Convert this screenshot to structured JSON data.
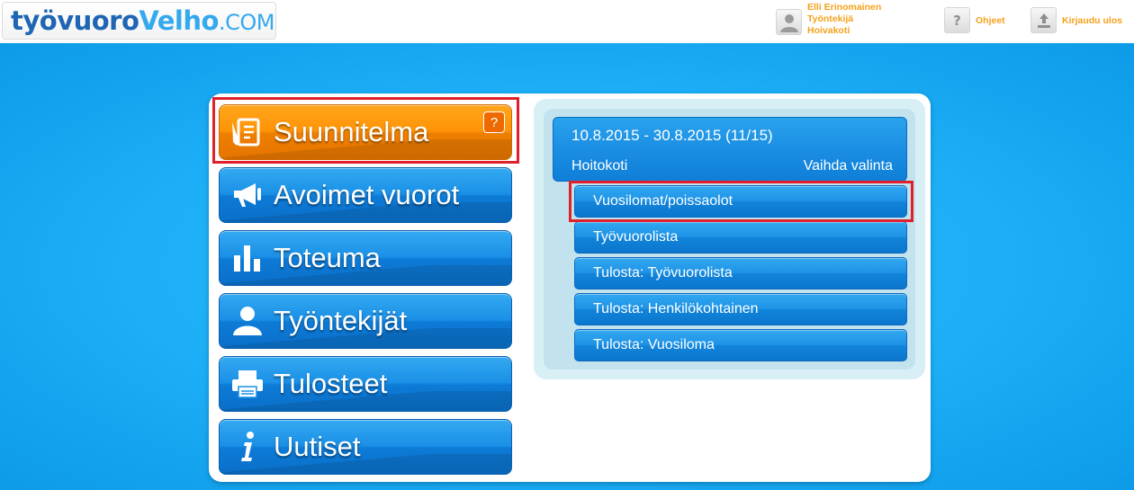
{
  "logo": {
    "part1": "työvuoro",
    "part2": "Velho",
    "part3": ".COM"
  },
  "header": {
    "user": {
      "name": "Elli Erinomainen",
      "role": "Työntekijä",
      "unit": "Hoivakoti"
    },
    "help_label": "Ohjeet",
    "logout_label": "Kirjaudu ulos",
    "help_icon_glyph": "?"
  },
  "menu": [
    {
      "label": "Suunnitelma",
      "icon": "plan-document-icon",
      "active": true,
      "help": "?"
    },
    {
      "label": "Avoimet vuorot",
      "icon": "megaphone-icon",
      "active": false
    },
    {
      "label": "Toteuma",
      "icon": "bar-chart-icon",
      "active": false
    },
    {
      "label": "Työntekijät",
      "icon": "person-icon",
      "active": false
    },
    {
      "label": "Tulosteet",
      "icon": "printer-icon",
      "active": false
    },
    {
      "label": "Uutiset",
      "icon": "info-icon",
      "active": false
    }
  ],
  "period": {
    "range": "10.8.2015 - 30.8.2015 (11/15)",
    "unit": "Hoitokoti",
    "change_label": "Vaihda valinta"
  },
  "submenu": [
    {
      "label": "Vuosilomat/poissaolot",
      "highlighted": true
    },
    {
      "label": "Työvuorolista"
    },
    {
      "label": "Tulosta: Työvuorolista"
    },
    {
      "label": "Tulosta: Henkilökohtainen"
    },
    {
      "label": "Tulosta: Vuosiloma"
    }
  ],
  "colors": {
    "accent_orange": "#ff9306",
    "accent_blue": "#1a8fe6",
    "highlight_red": "#e0212b",
    "header_text": "#f5a21c"
  }
}
